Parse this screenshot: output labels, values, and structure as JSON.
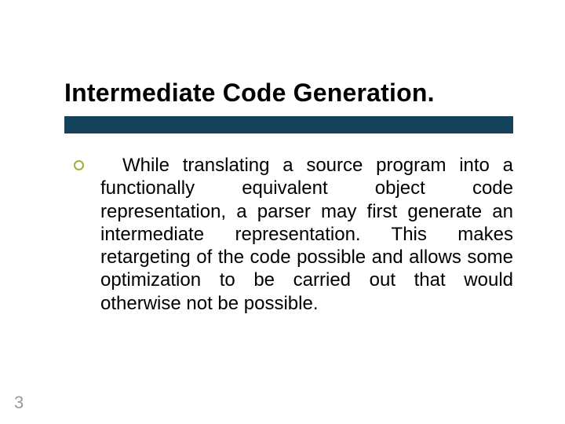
{
  "slide": {
    "title": "Intermediate Code Generation.",
    "body": "While translating a source program into a functionally equivalent object code representation, a parser may first generate an intermediate representation. This makes retargeting of the code possible and allows some optimization to be carried out that would otherwise not be possible.",
    "page_number": "3",
    "colors": {
      "rule": "#14425c",
      "bullet_border": "#9ab23a",
      "page_number": "#9a9a9a"
    }
  }
}
